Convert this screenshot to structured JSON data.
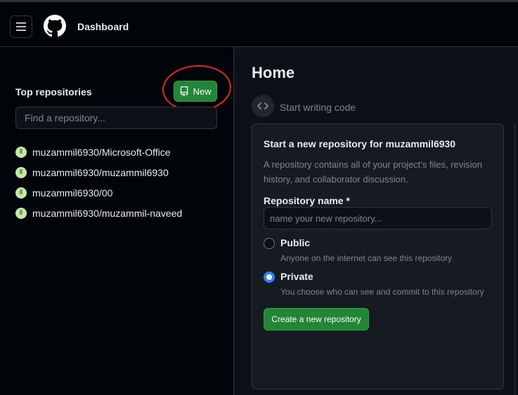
{
  "header": {
    "title": "Dashboard",
    "menu_icon": "hamburger-icon",
    "logo_icon": "github-logo-icon"
  },
  "sidebar": {
    "title": "Top repositories",
    "new_button": {
      "label": "New",
      "icon": "repo-icon"
    },
    "search": {
      "placeholder": "Find a repository..."
    },
    "repos": [
      {
        "name": "muzammil6930/Microsoft-Office"
      },
      {
        "name": "muzammil6930/muzammil6930"
      },
      {
        "name": "muzammil6930/00"
      },
      {
        "name": "muzammil6930/muzammil-naveed"
      }
    ]
  },
  "main": {
    "title": "Home",
    "start_writing": {
      "label": "Start writing code",
      "icon": "code-icon"
    },
    "card": {
      "title": "Start a new repository for muzammil6930",
      "description": "A repository contains all of your project's files, revision history, and collaborator discussion.",
      "repo_name_label": "Repository name *",
      "repo_name_placeholder": "name your new repository...",
      "visibility_options": [
        {
          "label": "Public",
          "note": "Anyone on the internet can see this repository",
          "selected": false
        },
        {
          "label": "Private",
          "note": "You choose who can see and commit to this repository",
          "selected": true
        }
      ],
      "create_button": "Create a new repository"
    }
  },
  "colors": {
    "background": "#010409",
    "panel": "#0d1117",
    "card": "#161b22",
    "border": "#30363d",
    "accent_green": "#238636",
    "radio_blue": "#2f81f7",
    "annotation_red": "#e5262b"
  }
}
